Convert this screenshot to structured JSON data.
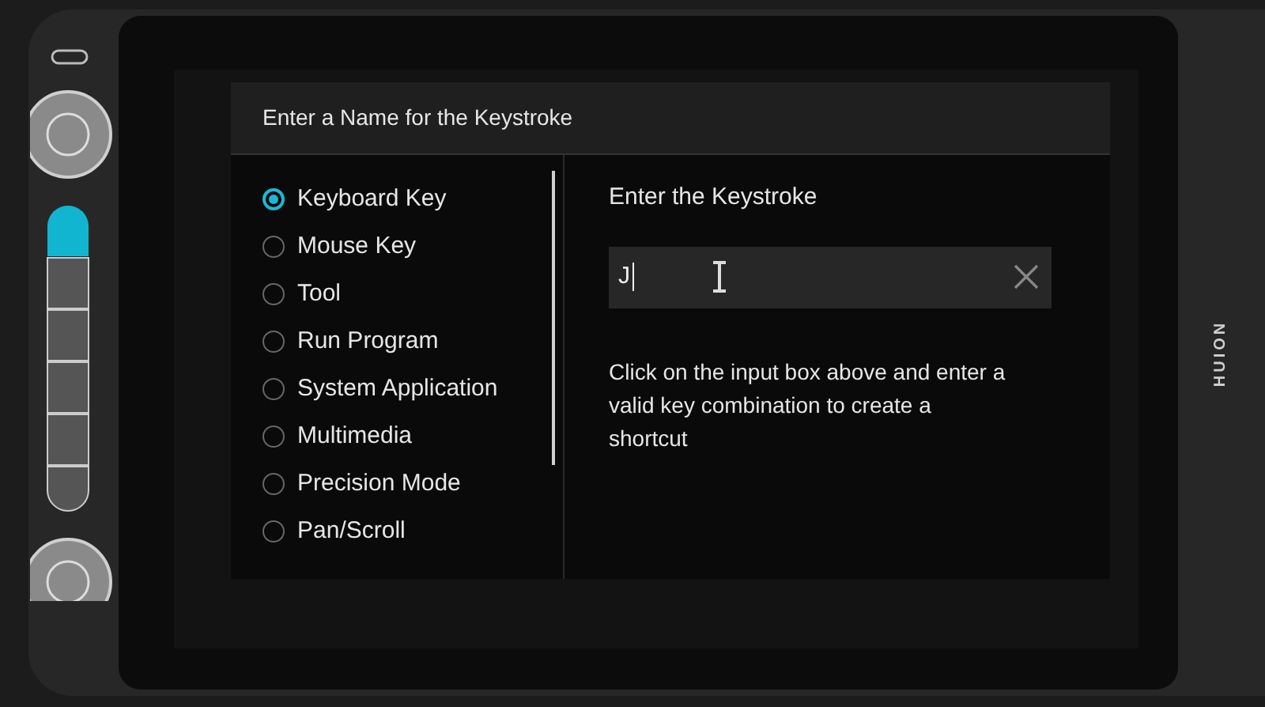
{
  "device": {
    "brand": "HUION"
  },
  "dialog": {
    "title": "Enter a Name for the Keystroke",
    "options": [
      {
        "label": "Keyboard Key",
        "selected": true
      },
      {
        "label": "Mouse Key",
        "selected": false
      },
      {
        "label": "Tool",
        "selected": false
      },
      {
        "label": "Run Program",
        "selected": false
      },
      {
        "label": "System Application",
        "selected": false
      },
      {
        "label": "Multimedia",
        "selected": false
      },
      {
        "label": "Precision Mode",
        "selected": false
      },
      {
        "label": "Pan/Scroll",
        "selected": false
      }
    ],
    "heading": "Enter the Keystroke",
    "keystroke_field": {
      "value": "J"
    },
    "help": "Click on the input box above and enter a valid key combination to create a shortcut"
  }
}
